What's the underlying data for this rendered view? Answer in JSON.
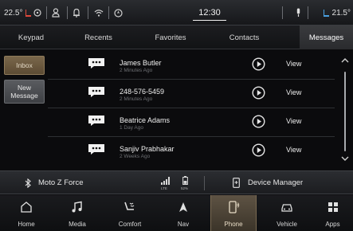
{
  "status": {
    "temp_left": "22.5°",
    "temp_right": "21.5°",
    "time": "12:30"
  },
  "tabs": [
    {
      "label": "Keypad"
    },
    {
      "label": "Recents"
    },
    {
      "label": "Favorites"
    },
    {
      "label": "Contacts"
    },
    {
      "label": "Messages",
      "active": true
    }
  ],
  "left_nav": {
    "inbox": "Inbox",
    "new_message": "New Message"
  },
  "messages": [
    {
      "name": "James Butler",
      "time": "2 Minutes Ago",
      "action": "View"
    },
    {
      "name": "248-576-5459",
      "time": "2 Minutes Ago",
      "action": "View"
    },
    {
      "name": "Beatrice Adams",
      "time": "1 Day Ago",
      "action": "View"
    },
    {
      "name": "Sanjiv Prabhakar",
      "time": "2 Weeks Ago",
      "action": "View"
    }
  ],
  "device": {
    "name": "Moto Z Force",
    "network": "LTE",
    "battery": "52%",
    "manager_label": "Device Manager"
  },
  "bottom_nav": [
    {
      "label": "Home",
      "icon": "home-icon"
    },
    {
      "label": "Media",
      "icon": "music-note-icon"
    },
    {
      "label": "Comfort",
      "icon": "seat-comfort-icon"
    },
    {
      "label": "Nav",
      "icon": "navigation-arrow-icon"
    },
    {
      "label": "Phone",
      "icon": "phone-icon",
      "active": true
    },
    {
      "label": "Vehicle",
      "icon": "car-icon"
    },
    {
      "label": "Apps",
      "icon": "apps-grid-icon"
    }
  ],
  "colors": {
    "active_accent": "#7a674b",
    "background": "#0b0b0d"
  }
}
